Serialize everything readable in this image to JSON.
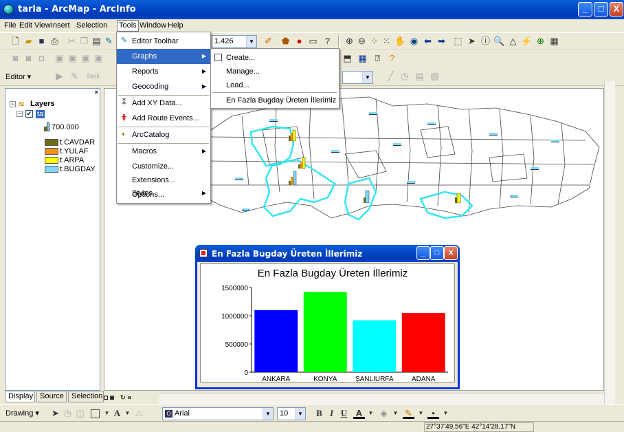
{
  "window": {
    "title": "tarla - ArcMap - ArcInfo",
    "min": "_",
    "max": "□",
    "close": "X"
  },
  "menubar": [
    "File",
    "Edit",
    "View",
    "Insert",
    "Selection",
    "Tools",
    "Window",
    "Help"
  ],
  "toolbar": {
    "scale_value": "1.426",
    "editor_label": "Editor",
    "task_label": "Task"
  },
  "tools_menu": {
    "items": [
      "Editor Toolbar",
      "Graphs",
      "Reports",
      "Geocoding",
      "Add XY Data...",
      "Add Route Events...",
      "ArcCatalog",
      "Macros",
      "Customize...",
      "Extensions...",
      "Styles",
      "Options..."
    ]
  },
  "graphs_menu": {
    "items": [
      "Create...",
      "Manage...",
      "Load...",
      "En  Fazla Bugday Üreten İllerimiz"
    ]
  },
  "toc": {
    "root_label": "Layers",
    "layer_label": "ta",
    "size_label": "700.000",
    "legend": [
      {
        "label": "t.CAVDAR",
        "color": "#6b6b1a"
      },
      {
        "label": "t.YULAF",
        "color": "#f09020"
      },
      {
        "label": "t.ARPA",
        "color": "#ffff00"
      },
      {
        "label": "t.BUGDAY",
        "color": "#7fd8f8"
      }
    ]
  },
  "toc_tabs": [
    "Display",
    "Source",
    "Selection"
  ],
  "chart_window": {
    "title": "En  Fazla Bugday Üreten İllerimiz"
  },
  "chart_data": {
    "type": "bar",
    "title": "En  Fazla Bugday Üreten İllerimiz",
    "categories": [
      "ANKARA",
      "KONYA",
      "ŞANLIURFA",
      "ADANA"
    ],
    "values": [
      1100000,
      1420000,
      920000,
      1050000
    ],
    "colors": [
      "#0000ff",
      "#00ff00",
      "#00ffff",
      "#ff0000"
    ],
    "ylim": [
      0,
      1500000
    ],
    "yticks": [
      "1500000",
      "1000000",
      "500000",
      "0"
    ],
    "xlabel": "",
    "ylabel": ""
  },
  "drawing_toolbar": {
    "drawing_label": "Drawing",
    "font_name": "Arial",
    "font_size": "10",
    "bold": "B",
    "italic": "I",
    "underline": "U"
  },
  "status": {
    "coords": "27°37'49,56\"E  42°14'28,17\"N"
  }
}
